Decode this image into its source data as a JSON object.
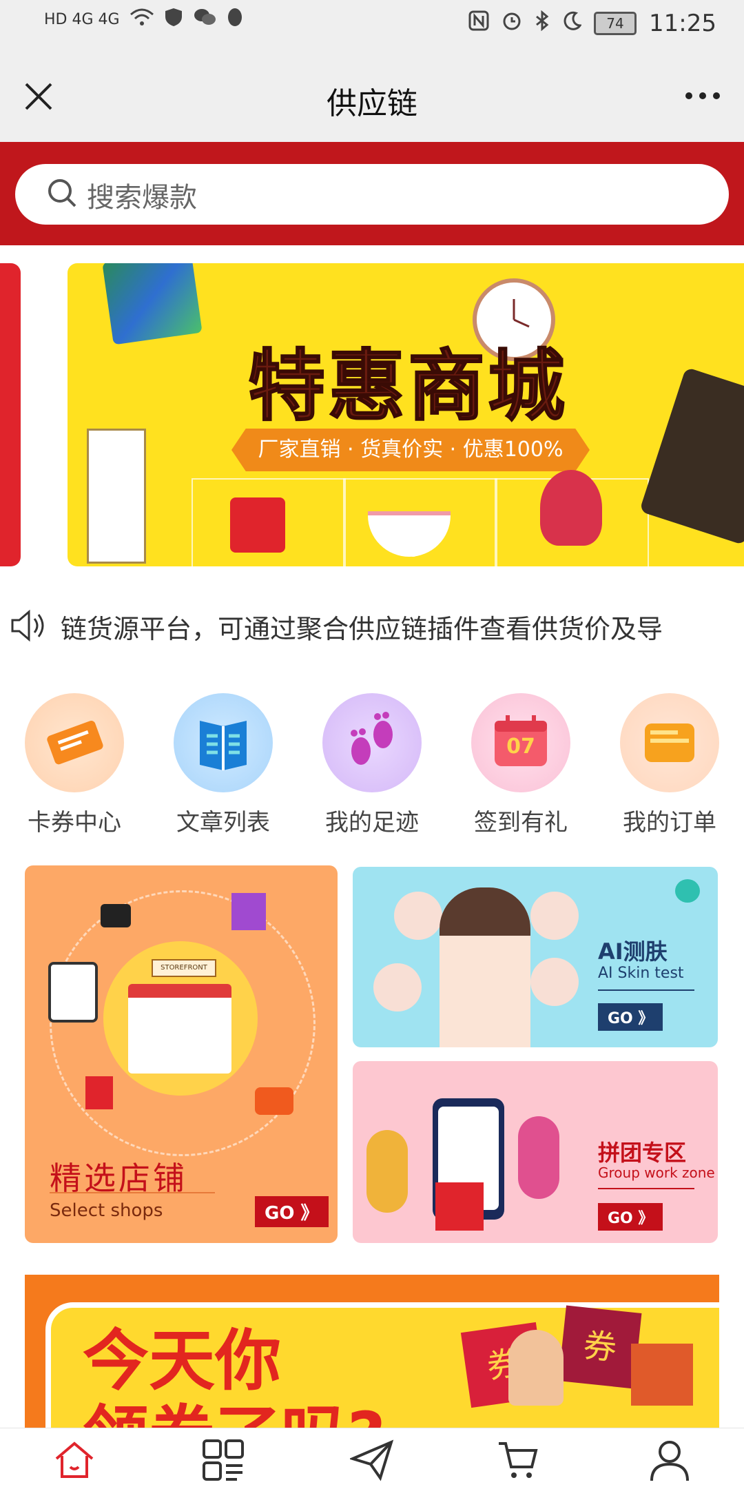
{
  "status_bar": {
    "left_text": "HD 4G 4G",
    "battery": "74",
    "time": "11:25"
  },
  "titlebar": {
    "title": "供应链"
  },
  "search": {
    "placeholder": "搜索爆款"
  },
  "banner": {
    "title": "特惠商城",
    "subtitle": "厂家直销 · 货真价实 · 优惠100%"
  },
  "notice": {
    "text": "链货源平台，可通过聚合供应链插件查看供货价及导"
  },
  "quick_links": [
    {
      "label": "卡券中心",
      "icon": "ticket-icon"
    },
    {
      "label": "文章列表",
      "icon": "book-icon"
    },
    {
      "label": "我的足迹",
      "icon": "footprint-icon"
    },
    {
      "label": "签到有礼",
      "icon": "calendar-icon"
    },
    {
      "label": "我的订单",
      "icon": "order-icon"
    }
  ],
  "calendar_day": "07",
  "cards": {
    "shops": {
      "title": "精选店铺",
      "subtitle": "Select shops",
      "go": "GO 》",
      "store_sign": "STOREFRONT"
    },
    "ai": {
      "title": "AI测肤",
      "subtitle": "AI Skin test",
      "go": "GO 》"
    },
    "group": {
      "title": "拼团专区",
      "subtitle": "Group work zone",
      "go": "GO 》"
    }
  },
  "coupon_banner": {
    "line1": "今天你",
    "line2": "领券了吗?",
    "tag": "券"
  },
  "bottom_nav": [
    {
      "name": "home",
      "icon": "home-icon"
    },
    {
      "name": "category",
      "icon": "category-icon"
    },
    {
      "name": "send",
      "icon": "send-icon"
    },
    {
      "name": "cart",
      "icon": "cart-icon"
    },
    {
      "name": "profile",
      "icon": "user-icon"
    }
  ],
  "colors": {
    "header_red": "#c0171c",
    "banner_yellow": "#ffe11f",
    "nav_active": "#e0242c"
  }
}
